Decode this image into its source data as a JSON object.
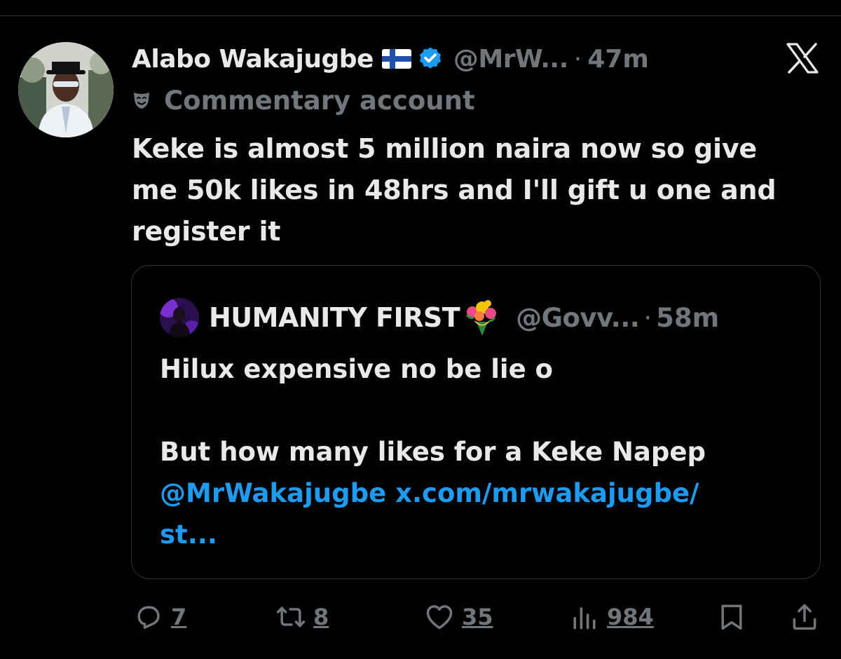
{
  "tweet": {
    "author": {
      "display_name": "Alabo Wakajugbe",
      "flag": "finland-flag",
      "verified": true,
      "handle": "@MrW...",
      "time": "47m"
    },
    "label": {
      "icon": "theater-mask-icon",
      "text": "Commentary account"
    },
    "text_lines": [
      "Keke is almost 5 million naira now so give",
      "me 50k likes in 48hrs and I'll gift u one and",
      "register it"
    ],
    "separator": "·"
  },
  "quote": {
    "author": {
      "display_name": "HUMANITY FIRST",
      "emoji": "bouquet-icon",
      "handle": "@Govv...",
      "time": "58m"
    },
    "line1": "Hilux expensive no be lie o",
    "line2": "But how many likes for a Keke Napep",
    "mention": "@MrWakajugbe",
    "link_part1": "x.com/mrwakajugbe/",
    "link_part2": "st..."
  },
  "actions": {
    "replies": "7",
    "reposts": "8",
    "likes": "35",
    "views": "984"
  },
  "colors": {
    "background": "#000000",
    "text_primary": "#e7e9ea",
    "text_secondary": "#71767b",
    "link": "#1d9bf0",
    "verified": "#1d9bf0",
    "border": "#2f3336"
  }
}
